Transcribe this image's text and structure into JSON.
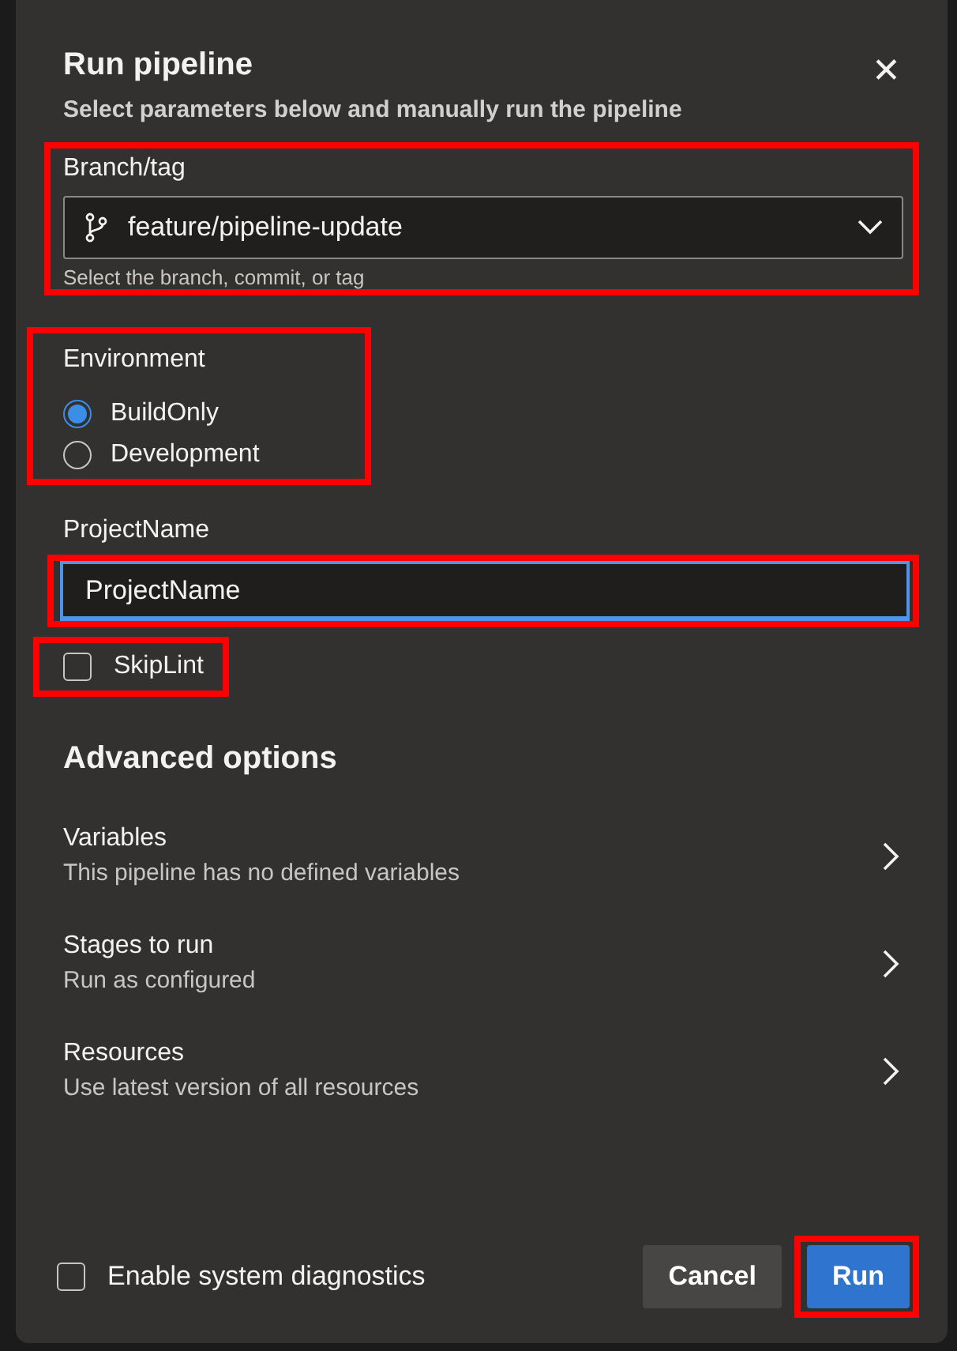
{
  "dialog": {
    "title": "Run pipeline",
    "subtitle": "Select parameters below and manually run the pipeline",
    "close": "✕"
  },
  "branch": {
    "label": "Branch/tag",
    "value": "feature/pipeline-update",
    "hint": "Select the branch, commit, or tag",
    "highlighted": true
  },
  "environment": {
    "label": "Environment",
    "highlighted": true,
    "options": [
      {
        "label": "BuildOnly",
        "selected": true
      },
      {
        "label": "Development",
        "selected": false
      }
    ]
  },
  "project_name": {
    "label": "ProjectName",
    "value": "ProjectName",
    "focused": true,
    "highlighted": true
  },
  "skip_lint": {
    "label": "SkipLint",
    "checked": false,
    "highlighted": true
  },
  "advanced": {
    "title": "Advanced options",
    "items": [
      {
        "title": "Variables",
        "description": "This pipeline has no defined variables"
      },
      {
        "title": "Stages to run",
        "description": "Run as configured"
      },
      {
        "title": "Resources",
        "description": "Use latest version of all resources"
      }
    ]
  },
  "footer": {
    "diagnostics": {
      "label": "Enable system diagnostics",
      "checked": false
    },
    "buttons": [
      {
        "label": "Cancel",
        "kind": "secondary",
        "highlighted": false
      },
      {
        "label": "Run",
        "kind": "primary",
        "highlighted": true
      }
    ]
  }
}
